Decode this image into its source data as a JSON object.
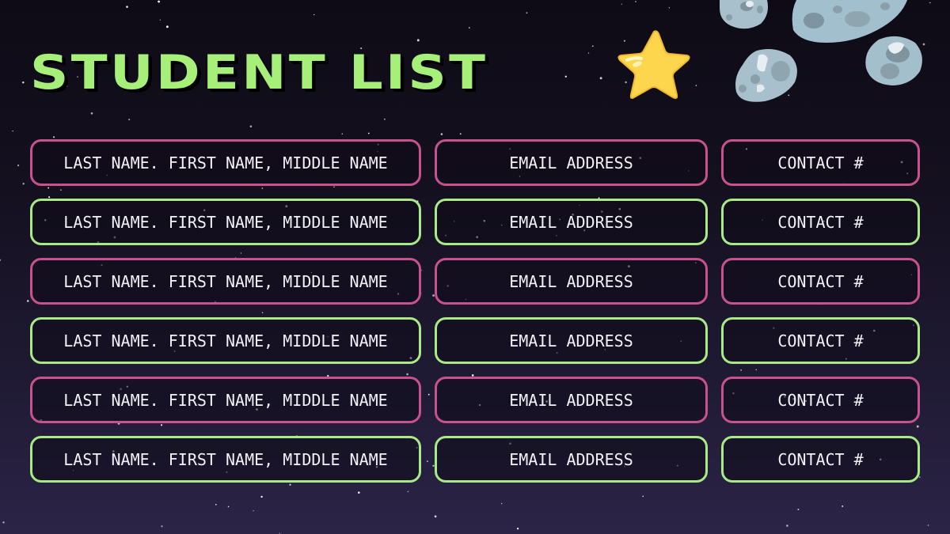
{
  "slide": {
    "title": "STUDENT LIST",
    "decorations": [
      "star-icon",
      "asteroid-icon"
    ],
    "colors": {
      "title": "#a6f07a",
      "border_pink": "#c8518f",
      "border_green": "#a7ea86",
      "text": "#f3f1f7",
      "background_top": "#0e0b16",
      "background_bottom": "#2b2447",
      "star": "#fdd64e",
      "asteroid": "#9fb8c4"
    }
  },
  "rows": [
    {
      "style": "pink",
      "name": "LAST NAME. FIRST NAME, MIDDLE NAME",
      "email": "EMAIL ADDRESS",
      "contact": "CONTACT #"
    },
    {
      "style": "green",
      "name": "LAST NAME. FIRST NAME, MIDDLE NAME",
      "email": "EMAIL ADDRESS",
      "contact": "CONTACT #"
    },
    {
      "style": "pink",
      "name": "LAST NAME. FIRST NAME, MIDDLE NAME",
      "email": "EMAIL ADDRESS",
      "contact": "CONTACT #"
    },
    {
      "style": "green",
      "name": "LAST NAME. FIRST NAME, MIDDLE NAME",
      "email": "EMAIL ADDRESS",
      "contact": "CONTACT #"
    },
    {
      "style": "pink",
      "name": "LAST NAME. FIRST NAME, MIDDLE NAME",
      "email": "EMAIL ADDRESS",
      "contact": "CONTACT #"
    },
    {
      "style": "green",
      "name": "LAST NAME. FIRST NAME, MIDDLE NAME",
      "email": "EMAIL ADDRESS",
      "contact": "CONTACT #"
    }
  ]
}
